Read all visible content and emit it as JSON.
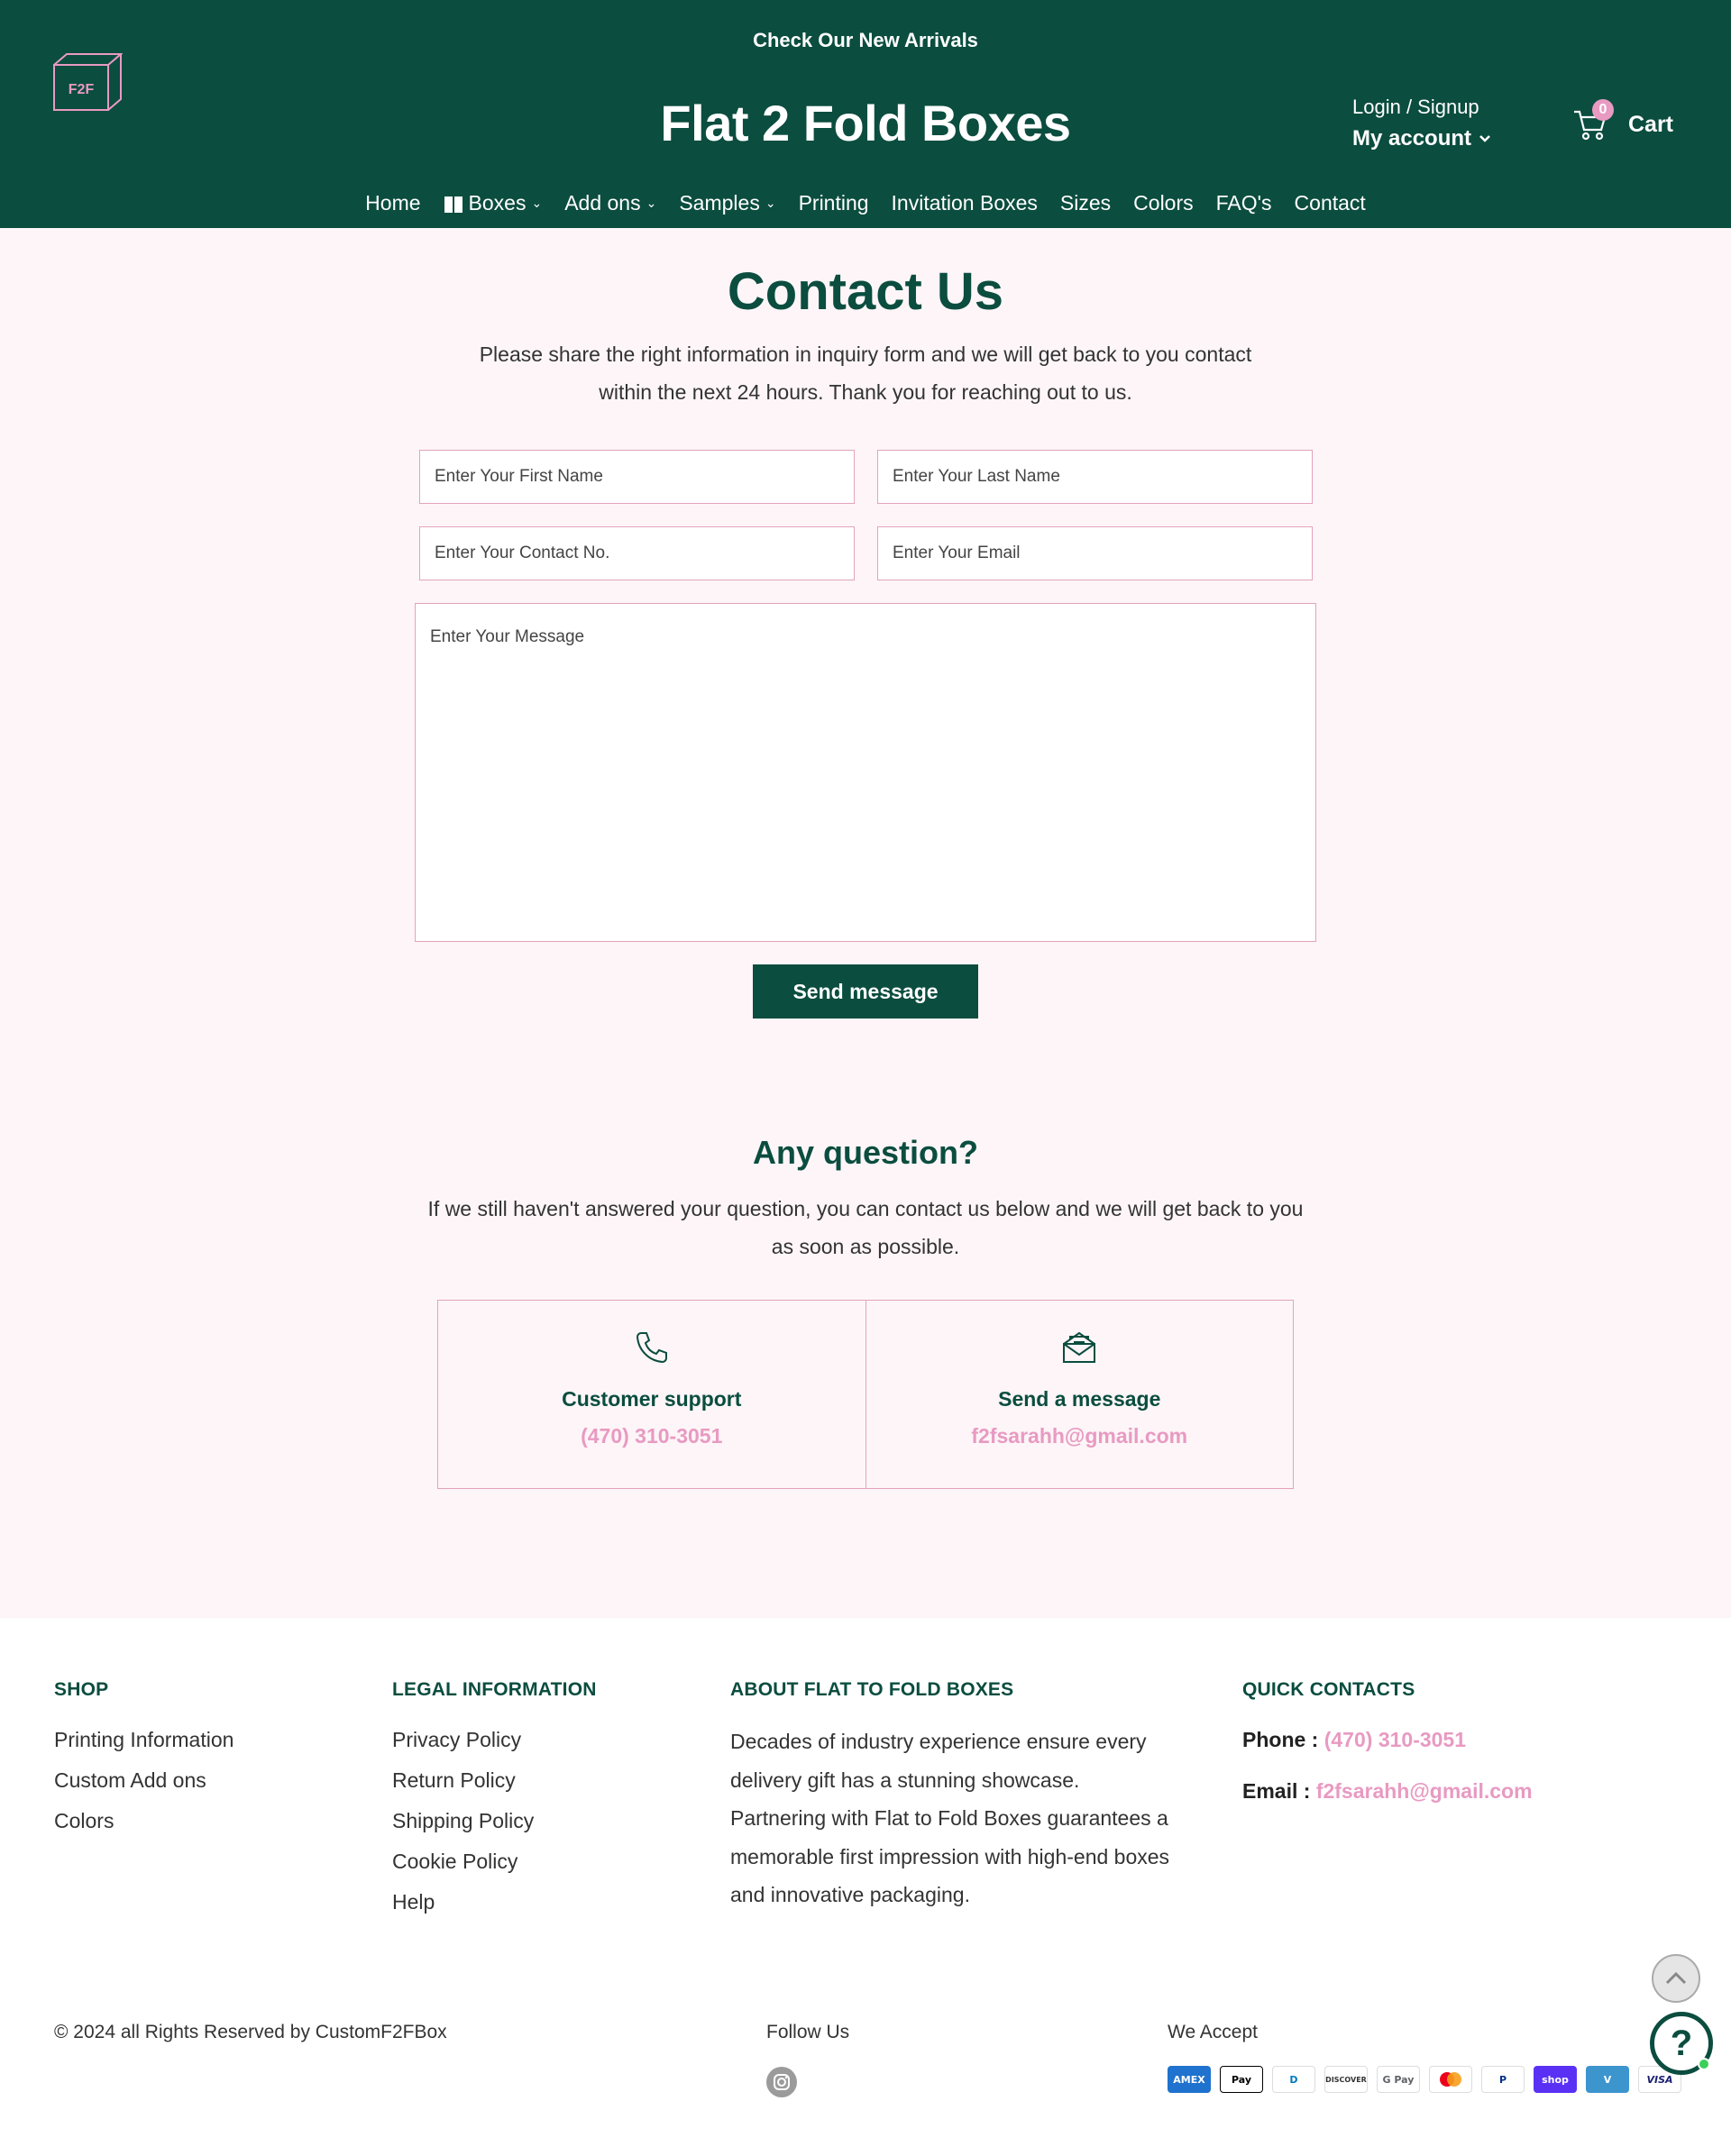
{
  "header": {
    "announcement": "Check Our New Arrivals",
    "logo_text": "F2F",
    "site_title": "Flat 2 Fold Boxes",
    "login_label": "Login / Signup",
    "account_label": "My account",
    "cart_count": "0",
    "cart_label": "Cart"
  },
  "nav": {
    "items": [
      "Home",
      "Boxes",
      "Add ons",
      "Samples",
      "Printing",
      "Invitation Boxes",
      "Sizes",
      "Colors",
      "FAQ's",
      "Contact"
    ]
  },
  "contact": {
    "title": "Contact Us",
    "intro": "Please share the right information in inquiry form and we will get back to you contact within the next 24 hours. Thank you for reaching out to us.",
    "first_name_placeholder": "Enter Your First Name",
    "last_name_placeholder": "Enter Your Last Name",
    "contact_no_placeholder": "Enter Your Contact No.",
    "email_placeholder": "Enter Your Email",
    "message_placeholder": "Enter Your Message",
    "send_label": "Send message"
  },
  "question": {
    "title": "Any question?",
    "text": "If we still haven't answered your question, you can contact us below and we will get back to you as soon as possible.",
    "support_title": "Customer support",
    "support_phone": "(470) 310-3051",
    "message_title": "Send a message",
    "message_email": "f2fsarahh@gmail.com"
  },
  "footer": {
    "shop_heading": "SHOP",
    "shop_links": [
      "Printing Information",
      "Custom Add ons",
      "Colors"
    ],
    "legal_heading": "LEGAL INFORMATION",
    "legal_links": [
      "Privacy Policy",
      "Return Policy",
      "Shipping Policy",
      "Cookie Policy",
      "Help"
    ],
    "about_heading": "ABOUT FLAT TO FOLD BOXES",
    "about_text": "Decades of industry experience ensure every delivery gift has a stunning showcase. Partnering with Flat to Fold Boxes guarantees a memorable first impression with high-end boxes and innovative packaging.",
    "quick_heading": "QUICK CONTACTS",
    "phone_label": "Phone :",
    "phone_value": "(470) 310-3051",
    "email_label": "Email :",
    "email_value": "f2fsarahh@gmail.com",
    "copyright": "© 2024 all Rights Reserved by CustomF2FBox",
    "follow_label": "Follow Us",
    "accept_label": "We Accept",
    "payment_methods": [
      "AMEX",
      "Pay",
      "D",
      "DISCOVER",
      "G Pay",
      "",
      "P",
      "shop",
      "V",
      "VISA"
    ]
  },
  "colors": {
    "brand_green": "#0b4d3f",
    "accent_pink": "#e89ac2",
    "page_bg": "#fdf5f7"
  },
  "icons": {
    "logo": "box-logo-icon",
    "cart": "cart-icon",
    "phone": "phone-icon",
    "mail": "envelope-open-icon",
    "instagram": "instagram-icon",
    "scroll_top": "chevron-up-icon",
    "help": "help-question-icon"
  }
}
